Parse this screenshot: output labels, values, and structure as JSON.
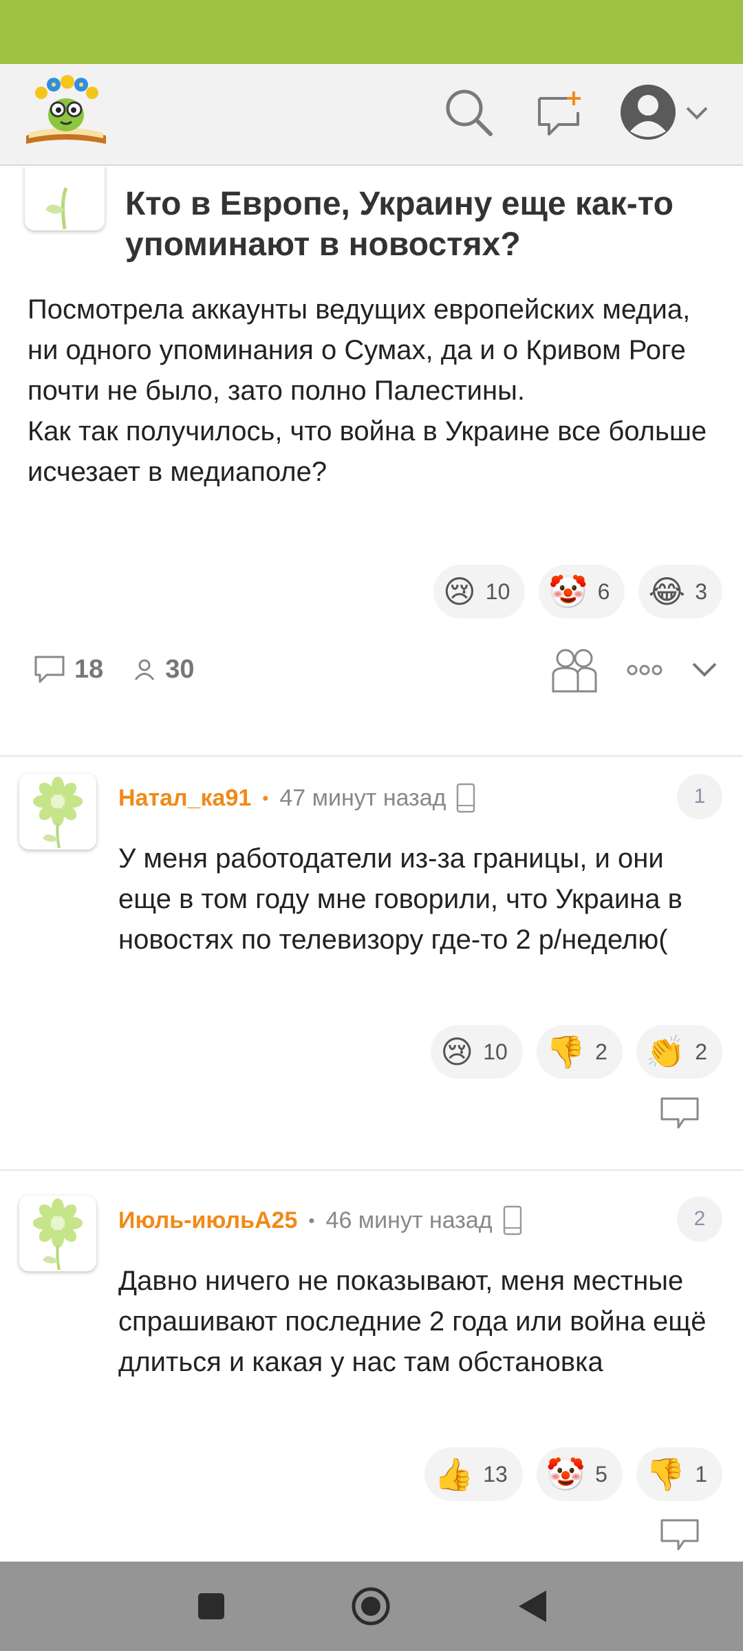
{
  "header": {
    "logo_name": "flower-book-logo",
    "icons": [
      "search-icon",
      "new-post-icon",
      "profile-avatar-icon",
      "chevron-down-icon"
    ]
  },
  "post": {
    "title": "Кто в Европе, Украину еще как-то упоминают в новостях?",
    "body": "Посмотрела аккаунты ведущих европейских медиа, ни одного упоминания о Сумах, да и о Кривом Роге почти не было, зато полно Палестины.\nКак так получилось, что война в Украине все больше исчезает в медиаполе?",
    "reactions": [
      {
        "emoji": "😢",
        "count": "10"
      },
      {
        "emoji": "🤡",
        "count": "6"
      },
      {
        "emoji": "😂",
        "count": "3"
      }
    ],
    "comments_count": "18",
    "followers_count": "30"
  },
  "comments": [
    {
      "author": "Натал_ка91",
      "time": "47 минут назад",
      "number": "1",
      "text": "У меня работодатели из-за границы, и они еще в том году мне говорили, что Украина в новостях по телевизору где-то 2 р/неделю(",
      "reactions": [
        {
          "emoji": "😢",
          "count": "10"
        },
        {
          "emoji": "👎",
          "count": "2"
        },
        {
          "emoji": "👏",
          "count": "2"
        }
      ]
    },
    {
      "author": "Июль-июльА25",
      "time": "46 минут назад",
      "number": "2",
      "text": "Давно ничего не показывают, меня местные спрашивают последние 2 года или война ещё длиться и какая у нас там обстановка",
      "reactions": [
        {
          "emoji": "👍",
          "count": "13"
        },
        {
          "emoji": "🤡",
          "count": "5"
        },
        {
          "emoji": "👎",
          "count": "1"
        }
      ]
    }
  ],
  "colors": {
    "status_bar": "#9ec043",
    "author_orange": "#f08a17",
    "nav_bar": "#959595"
  }
}
